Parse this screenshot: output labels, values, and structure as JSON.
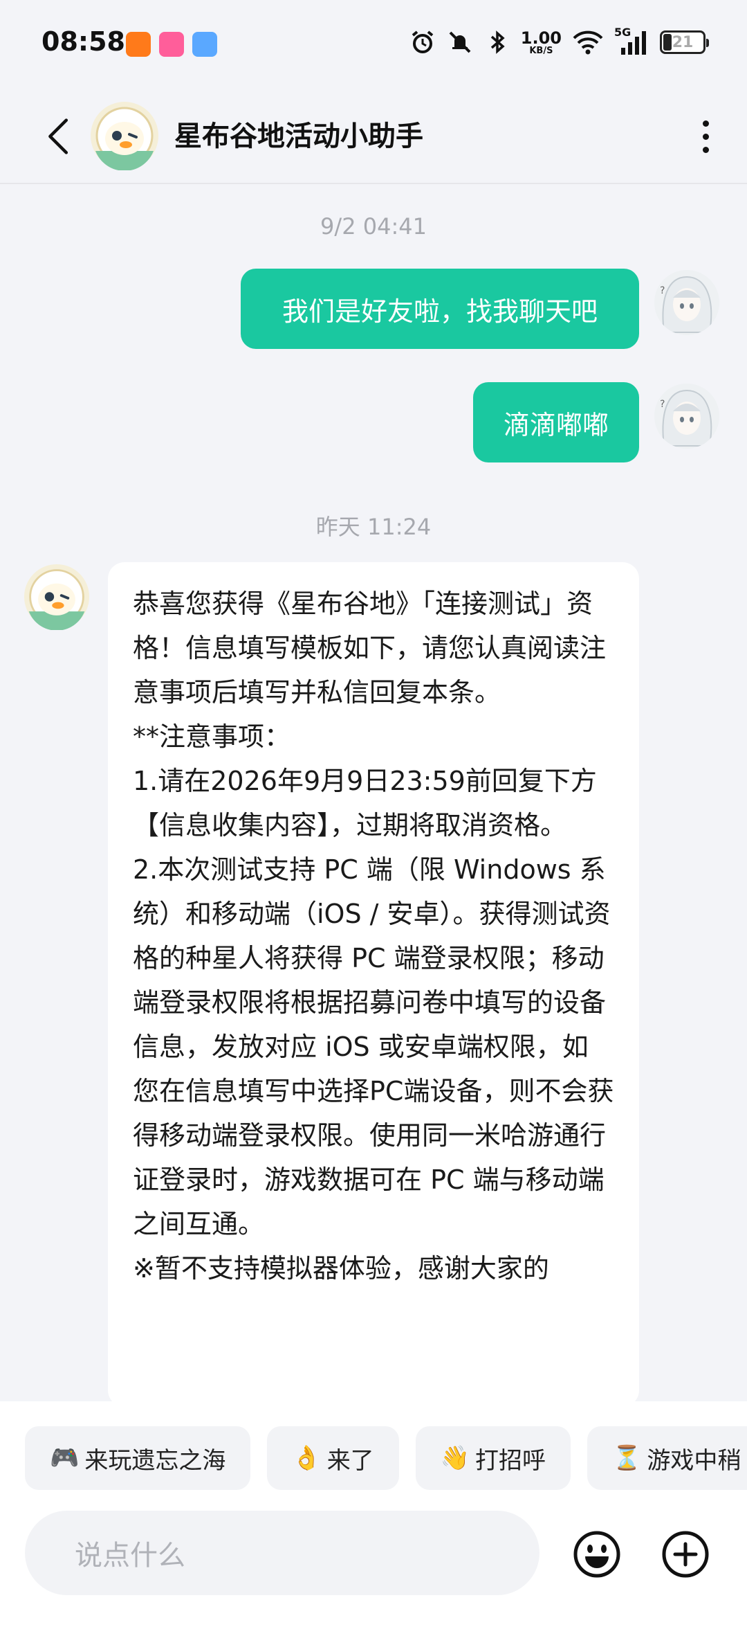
{
  "status_bar": {
    "time": "08:58",
    "net_speed": "1.00",
    "net_unit": "KB/S",
    "signal": "5G",
    "battery": "21"
  },
  "header": {
    "title": "星布谷地活动小助手"
  },
  "chat": {
    "timestamp_1": "9/2  04:41",
    "msg_out_1": "我们是好友啦，找我聊天吧",
    "msg_out_2": "滴滴嘟嘟",
    "timestamp_2": "昨天  11:24",
    "msg_in_1": "恭喜您获得《星布谷地》「连接测试」资格！信息填写模板如下，请您认真阅读注意事项后填写并私信回复本条。\n**注意事项：\n1.请在2026年9月9日23:59前回复下方【信息收集内容】，过期将取消资格。\n2.本次测试支持 PC 端（限 Windows 系统）和移动端（iOS / 安卓）。获得测试资格的种星人将获得 PC 端登录权限；移动端登录权限将根据招募问卷中填写的设备信息，发放对应 iOS 或安卓端权限，如您在信息填写中选择PC端设备，则不会获得移动端登录权限。使用同一米哈游通行证登录时，游戏数据可在 PC 端与移动端之间互通。\n※暂不支持模拟器体验，感谢大家的"
  },
  "quick_replies": [
    {
      "icon": "🎮",
      "label": "来玩遗忘之海"
    },
    {
      "icon": "👌",
      "label": "来了"
    },
    {
      "icon": "👋",
      "label": "打招呼"
    },
    {
      "icon": "⏳",
      "label": "游戏中稍"
    }
  ],
  "input": {
    "placeholder": "说点什么"
  },
  "colors": {
    "accent": "#1ac8a0",
    "background": "#f3f4f8"
  }
}
